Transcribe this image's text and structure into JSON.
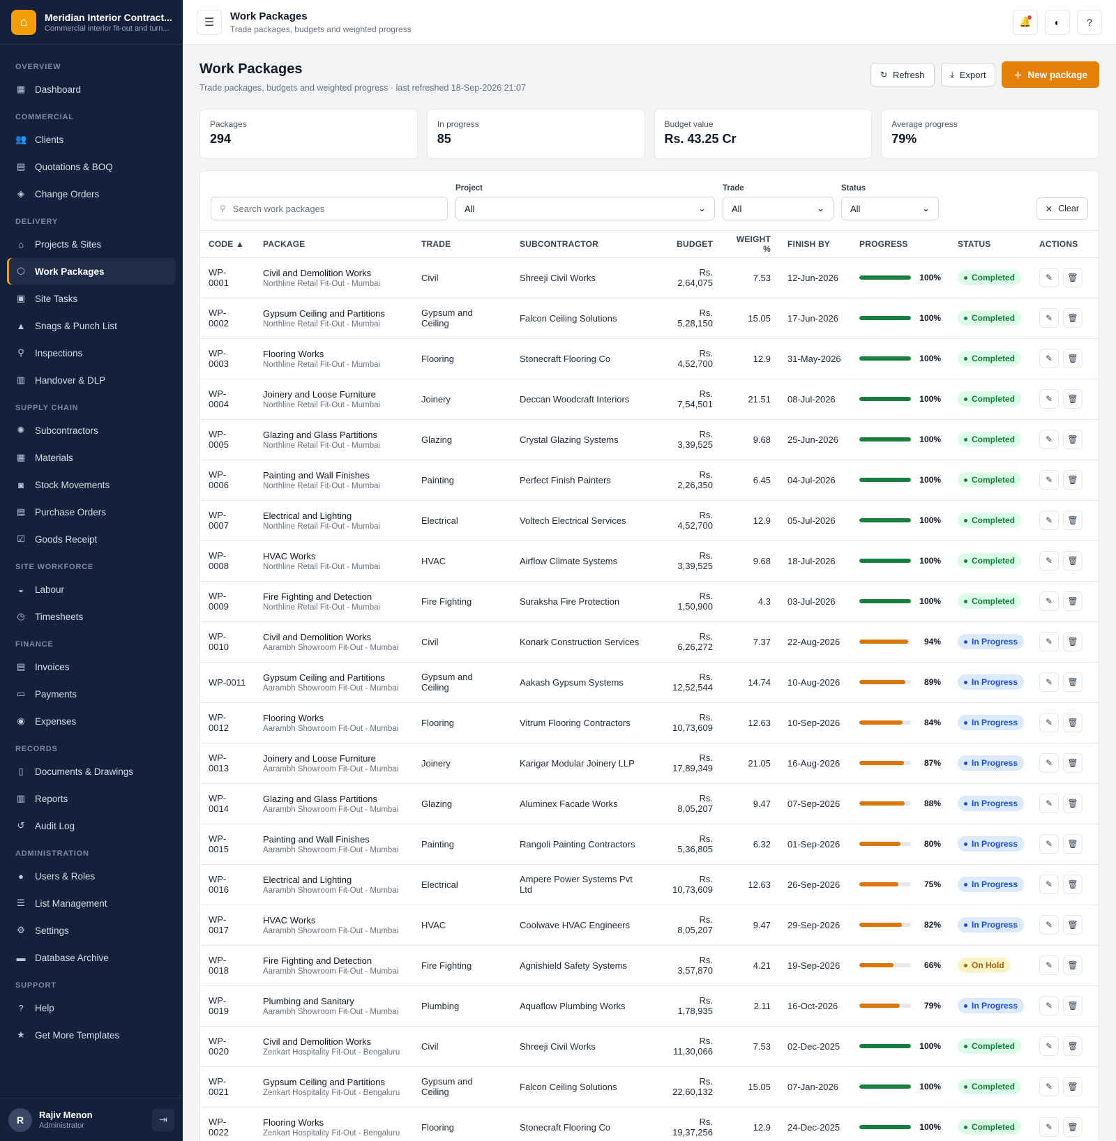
{
  "brand": {
    "name": "Meridian Interior Contract...",
    "tagline": "Commercial interior fit-out and turn...",
    "logo_icon": "home-icon"
  },
  "sidebar": {
    "sections": [
      {
        "title": "OVERVIEW",
        "items": [
          {
            "label": "Dashboard",
            "icon": "dashboard-icon",
            "glyph": "▦"
          }
        ]
      },
      {
        "title": "COMMERCIAL",
        "items": [
          {
            "label": "Clients",
            "icon": "users-icon",
            "glyph": "👥"
          },
          {
            "label": "Quotations & BOQ",
            "icon": "document-icon",
            "glyph": "▤"
          },
          {
            "label": "Change Orders",
            "icon": "change-icon",
            "glyph": "◈"
          }
        ]
      },
      {
        "title": "DELIVERY",
        "items": [
          {
            "label": "Projects & Sites",
            "icon": "home-icon",
            "glyph": "⌂"
          },
          {
            "label": "Work Packages",
            "icon": "cube-icon",
            "glyph": "⬡",
            "active": true
          },
          {
            "label": "Site Tasks",
            "icon": "clipboard-icon",
            "glyph": "▣"
          },
          {
            "label": "Snags & Punch List",
            "icon": "warning-icon",
            "glyph": "▲"
          },
          {
            "label": "Inspections",
            "icon": "magnifier-icon",
            "glyph": "⚲"
          },
          {
            "label": "Handover & DLP",
            "icon": "building-icon",
            "glyph": "▥"
          }
        ]
      },
      {
        "title": "SUPPLY CHAIN",
        "items": [
          {
            "label": "Subcontractors",
            "icon": "gear-icon",
            "glyph": "✺"
          },
          {
            "label": "Materials",
            "icon": "grid-icon",
            "glyph": "▦"
          },
          {
            "label": "Stock Movements",
            "icon": "camera-icon",
            "glyph": "◙"
          },
          {
            "label": "Purchase Orders",
            "icon": "list-icon",
            "glyph": "▤"
          },
          {
            "label": "Goods Receipt",
            "icon": "checkbox-icon",
            "glyph": "☑"
          }
        ]
      },
      {
        "title": "SITE WORKFORCE",
        "items": [
          {
            "label": "Labour",
            "icon": "helmet-icon",
            "glyph": "◒"
          },
          {
            "label": "Timesheets",
            "icon": "clock-icon",
            "glyph": "◷"
          }
        ]
      },
      {
        "title": "FINANCE",
        "items": [
          {
            "label": "Invoices",
            "icon": "invoice-icon",
            "glyph": "▤"
          },
          {
            "label": "Payments",
            "icon": "card-icon",
            "glyph": "▭"
          },
          {
            "label": "Expenses",
            "icon": "coin-icon",
            "glyph": "◉"
          }
        ]
      },
      {
        "title": "RECORDS",
        "items": [
          {
            "label": "Documents & Drawings",
            "icon": "file-icon",
            "glyph": "▯"
          },
          {
            "label": "Reports",
            "icon": "chart-icon",
            "glyph": "▥"
          },
          {
            "label": "Audit Log",
            "icon": "history-icon",
            "glyph": "↺"
          }
        ]
      },
      {
        "title": "ADMINISTRATION",
        "items": [
          {
            "label": "Users & Roles",
            "icon": "user-icon",
            "glyph": "●"
          },
          {
            "label": "List Management",
            "icon": "list-icon",
            "glyph": "☰"
          },
          {
            "label": "Settings",
            "icon": "settings-icon",
            "glyph": "⚙"
          },
          {
            "label": "Database Archive",
            "icon": "archive-icon",
            "glyph": "▬"
          }
        ]
      },
      {
        "title": "SUPPORT",
        "items": [
          {
            "label": "Help",
            "icon": "help-icon",
            "glyph": "?"
          },
          {
            "label": "Get More Templates",
            "icon": "star-icon",
            "glyph": "★"
          }
        ]
      }
    ]
  },
  "user": {
    "initial": "R",
    "name": "Rajiv Menon",
    "role": "Administrator"
  },
  "topbar": {
    "title": "Work Packages",
    "subtitle": "Trade packages, budgets and weighted progress"
  },
  "page": {
    "title": "Work Packages",
    "subtitle": "Trade packages, budgets and weighted progress · last refreshed 18-Sep-2026 21:07",
    "refresh_label": "Refresh",
    "export_label": "Export",
    "new_label": "New package"
  },
  "stats": [
    {
      "label": "Packages",
      "value": "294"
    },
    {
      "label": "In progress",
      "value": "85"
    },
    {
      "label": "Budget value",
      "value": "Rs. 43.25 Cr"
    },
    {
      "label": "Average progress",
      "value": "79%"
    }
  ],
  "filters": {
    "search_placeholder": "Search work packages",
    "project_label": "Project",
    "project_value": "All",
    "trade_label": "Trade",
    "trade_value": "All",
    "status_label": "Status",
    "status_value": "All",
    "clear_label": "Clear"
  },
  "table": {
    "columns": [
      "CODE ▲",
      "PACKAGE",
      "TRADE",
      "SUBCONTRACTOR",
      "BUDGET",
      "WEIGHT %",
      "FINISH BY",
      "PROGRESS",
      "STATUS",
      "ACTIONS"
    ],
    "rows": [
      {
        "code": "WP-0001",
        "name": "Civil and Demolition Works",
        "project": "Northline Retail Fit-Out - Mumbai",
        "trade": "Civil",
        "sub": "Shreeji Civil Works",
        "budget": "Rs. 2,64,075",
        "weight": "7.53",
        "finish": "12-Jun-2026",
        "progress": 100,
        "progress_label": "100%",
        "status": "Completed"
      },
      {
        "code": "WP-0002",
        "name": "Gypsum Ceiling and Partitions",
        "project": "Northline Retail Fit-Out - Mumbai",
        "trade": "Gypsum and Ceiling",
        "sub": "Falcon Ceiling Solutions",
        "budget": "Rs. 5,28,150",
        "weight": "15.05",
        "finish": "17-Jun-2026",
        "progress": 100,
        "progress_label": "100%",
        "status": "Completed"
      },
      {
        "code": "WP-0003",
        "name": "Flooring Works",
        "project": "Northline Retail Fit-Out - Mumbai",
        "trade": "Flooring",
        "sub": "Stonecraft Flooring Co",
        "budget": "Rs. 4,52,700",
        "weight": "12.9",
        "finish": "31-May-2026",
        "progress": 100,
        "progress_label": "100%",
        "status": "Completed"
      },
      {
        "code": "WP-0004",
        "name": "Joinery and Loose Furniture",
        "project": "Northline Retail Fit-Out - Mumbai",
        "trade": "Joinery",
        "sub": "Deccan Woodcraft Interiors",
        "budget": "Rs. 7,54,501",
        "weight": "21.51",
        "finish": "08-Jul-2026",
        "progress": 100,
        "progress_label": "100%",
        "status": "Completed"
      },
      {
        "code": "WP-0005",
        "name": "Glazing and Glass Partitions",
        "project": "Northline Retail Fit-Out - Mumbai",
        "trade": "Glazing",
        "sub": "Crystal Glazing Systems",
        "budget": "Rs. 3,39,525",
        "weight": "9.68",
        "finish": "25-Jun-2026",
        "progress": 100,
        "progress_label": "100%",
        "status": "Completed"
      },
      {
        "code": "WP-0006",
        "name": "Painting and Wall Finishes",
        "project": "Northline Retail Fit-Out - Mumbai",
        "trade": "Painting",
        "sub": "Perfect Finish Painters",
        "budget": "Rs. 2,26,350",
        "weight": "6.45",
        "finish": "04-Jul-2026",
        "progress": 100,
        "progress_label": "100%",
        "status": "Completed"
      },
      {
        "code": "WP-0007",
        "name": "Electrical and Lighting",
        "project": "Northline Retail Fit-Out - Mumbai",
        "trade": "Electrical",
        "sub": "Voltech Electrical Services",
        "budget": "Rs. 4,52,700",
        "weight": "12.9",
        "finish": "05-Jul-2026",
        "progress": 100,
        "progress_label": "100%",
        "status": "Completed"
      },
      {
        "code": "WP-0008",
        "name": "HVAC Works",
        "project": "Northline Retail Fit-Out - Mumbai",
        "trade": "HVAC",
        "sub": "Airflow Climate Systems",
        "budget": "Rs. 3,39,525",
        "weight": "9.68",
        "finish": "18-Jul-2026",
        "progress": 100,
        "progress_label": "100%",
        "status": "Completed"
      },
      {
        "code": "WP-0009",
        "name": "Fire Fighting and Detection",
        "project": "Northline Retail Fit-Out - Mumbai",
        "trade": "Fire Fighting",
        "sub": "Suraksha Fire Protection",
        "budget": "Rs. 1,50,900",
        "weight": "4.3",
        "finish": "03-Jul-2026",
        "progress": 100,
        "progress_label": "100%",
        "status": "Completed"
      },
      {
        "code": "WP-0010",
        "name": "Civil and Demolition Works",
        "project": "Aarambh Showroom Fit-Out - Mumbai",
        "trade": "Civil",
        "sub": "Konark Construction Services",
        "budget": "Rs. 6,26,272",
        "weight": "7.37",
        "finish": "22-Aug-2026",
        "progress": 94,
        "progress_label": "94%",
        "status": "In Progress"
      },
      {
        "code": "WP-0011",
        "name": "Gypsum Ceiling and Partitions",
        "project": "Aarambh Showroom Fit-Out - Mumbai",
        "trade": "Gypsum and Ceiling",
        "sub": "Aakash Gypsum Systems",
        "budget": "Rs. 12,52,544",
        "weight": "14.74",
        "finish": "10-Aug-2026",
        "progress": 89,
        "progress_label": "89%",
        "status": "In Progress"
      },
      {
        "code": "WP-0012",
        "name": "Flooring Works",
        "project": "Aarambh Showroom Fit-Out - Mumbai",
        "trade": "Flooring",
        "sub": "Vitrum Flooring Contractors",
        "budget": "Rs. 10,73,609",
        "weight": "12.63",
        "finish": "10-Sep-2026",
        "progress": 84,
        "progress_label": "84%",
        "status": "In Progress"
      },
      {
        "code": "WP-0013",
        "name": "Joinery and Loose Furniture",
        "project": "Aarambh Showroom Fit-Out - Mumbai",
        "trade": "Joinery",
        "sub": "Karigar Modular Joinery LLP",
        "budget": "Rs. 17,89,349",
        "weight": "21.05",
        "finish": "16-Aug-2026",
        "progress": 87,
        "progress_label": "87%",
        "status": "In Progress"
      },
      {
        "code": "WP-0014",
        "name": "Glazing and Glass Partitions",
        "project": "Aarambh Showroom Fit-Out - Mumbai",
        "trade": "Glazing",
        "sub": "Aluminex Facade Works",
        "budget": "Rs. 8,05,207",
        "weight": "9.47",
        "finish": "07-Sep-2026",
        "progress": 88,
        "progress_label": "88%",
        "status": "In Progress"
      },
      {
        "code": "WP-0015",
        "name": "Painting and Wall Finishes",
        "project": "Aarambh Showroom Fit-Out - Mumbai",
        "trade": "Painting",
        "sub": "Rangoli Painting Contractors",
        "budget": "Rs. 5,36,805",
        "weight": "6.32",
        "finish": "01-Sep-2026",
        "progress": 80,
        "progress_label": "80%",
        "status": "In Progress"
      },
      {
        "code": "WP-0016",
        "name": "Electrical and Lighting",
        "project": "Aarambh Showroom Fit-Out - Mumbai",
        "trade": "Electrical",
        "sub": "Ampere Power Systems Pvt Ltd",
        "budget": "Rs. 10,73,609",
        "weight": "12.63",
        "finish": "26-Sep-2026",
        "progress": 75,
        "progress_label": "75%",
        "status": "In Progress"
      },
      {
        "code": "WP-0017",
        "name": "HVAC Works",
        "project": "Aarambh Showroom Fit-Out - Mumbai",
        "trade": "HVAC",
        "sub": "Coolwave HVAC Engineers",
        "budget": "Rs. 8,05,207",
        "weight": "9.47",
        "finish": "29-Sep-2026",
        "progress": 82,
        "progress_label": "82%",
        "status": "In Progress"
      },
      {
        "code": "WP-0018",
        "name": "Fire Fighting and Detection",
        "project": "Aarambh Showroom Fit-Out - Mumbai",
        "trade": "Fire Fighting",
        "sub": "Agnishield Safety Systems",
        "budget": "Rs. 3,57,870",
        "weight": "4.21",
        "finish": "19-Sep-2026",
        "progress": 66,
        "progress_label": "66%",
        "status": "On Hold"
      },
      {
        "code": "WP-0019",
        "name": "Plumbing and Sanitary",
        "project": "Aarambh Showroom Fit-Out - Mumbai",
        "trade": "Plumbing",
        "sub": "Aquaflow Plumbing Works",
        "budget": "Rs. 1,78,935",
        "weight": "2.11",
        "finish": "16-Oct-2026",
        "progress": 79,
        "progress_label": "79%",
        "status": "In Progress"
      },
      {
        "code": "WP-0020",
        "name": "Civil and Demolition Works",
        "project": "Zenkart Hospitality Fit-Out - Bengaluru",
        "trade": "Civil",
        "sub": "Shreeji Civil Works",
        "budget": "Rs. 11,30,066",
        "weight": "7.53",
        "finish": "02-Dec-2025",
        "progress": 100,
        "progress_label": "100%",
        "status": "Completed"
      },
      {
        "code": "WP-0021",
        "name": "Gypsum Ceiling and Partitions",
        "project": "Zenkart Hospitality Fit-Out - Bengaluru",
        "trade": "Gypsum and Ceiling",
        "sub": "Falcon Ceiling Solutions",
        "budget": "Rs. 22,60,132",
        "weight": "15.05",
        "finish": "07-Jan-2026",
        "progress": 100,
        "progress_label": "100%",
        "status": "Completed"
      },
      {
        "code": "WP-0022",
        "name": "Flooring Works",
        "project": "Zenkart Hospitality Fit-Out - Bengaluru",
        "trade": "Flooring",
        "sub": "Stonecraft Flooring Co",
        "budget": "Rs. 19,37,256",
        "weight": "12.9",
        "finish": "24-Dec-2025",
        "progress": 100,
        "progress_label": "100%",
        "status": "Completed"
      }
    ]
  },
  "colors": {
    "accent": "#e67e0a",
    "progress_complete": "#15803d",
    "progress_partial": "#d97706",
    "sidebar_bg": "#14213d"
  }
}
